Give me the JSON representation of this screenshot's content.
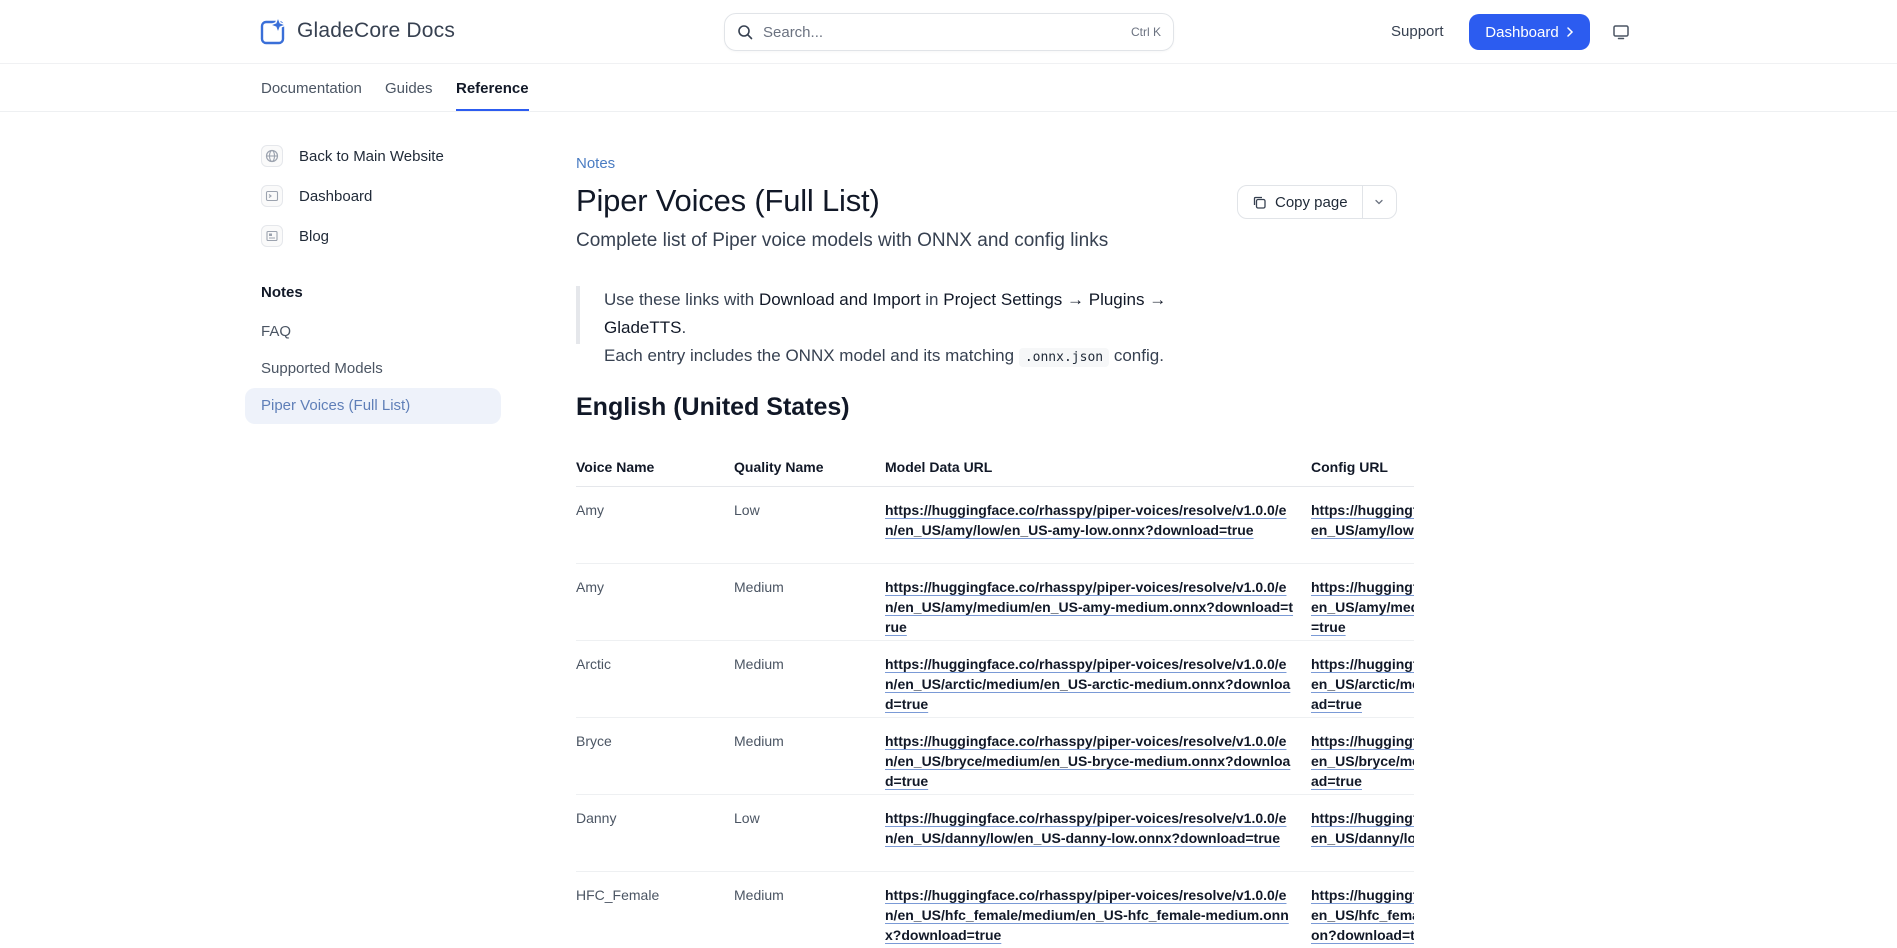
{
  "header": {
    "brand": "GladeCore Docs",
    "search_placeholder": "Search...",
    "search_shortcut": "Ctrl K",
    "support_label": "Support",
    "dashboard_label": "Dashboard",
    "accent_color": "#2c5cf0"
  },
  "tabs": [
    {
      "label": "Documentation",
      "active": false
    },
    {
      "label": "Guides",
      "active": false
    },
    {
      "label": "Reference",
      "active": true
    }
  ],
  "sidebar": {
    "links": [
      {
        "label": "Back to Main Website",
        "icon": "globe-icon"
      },
      {
        "label": "Dashboard",
        "icon": "terminal-icon"
      },
      {
        "label": "Blog",
        "icon": "newspaper-icon"
      }
    ],
    "group_title": "Notes",
    "items": [
      {
        "label": "FAQ",
        "active": false
      },
      {
        "label": "Supported Models",
        "active": false
      },
      {
        "label": "Piper Voices (Full List)",
        "active": true
      }
    ]
  },
  "page": {
    "eyebrow": "Notes",
    "title": "Piper Voices (Full List)",
    "subtitle": "Complete list of Piper voice models with ONNX and config links",
    "copy_label": "Copy page",
    "callout": {
      "l1_a": "Use these links with ",
      "l1_b": "Download and Import",
      "l1_c": " in ",
      "l1_d": "Project Settings → Plugins → GladeTTS",
      "l1_e": ".",
      "l2_a": "Each entry includes the ONNX model and its matching ",
      "l2_code": ".onnx.json",
      "l2_b": " config."
    },
    "section_title": "English (United States)"
  },
  "table": {
    "columns": [
      "Voice Name",
      "Quality Name",
      "Model Data URL",
      "Config URL"
    ],
    "rows": [
      {
        "voice": "Amy",
        "quality": "Low",
        "model": "https://huggingface.co/rhasspy/piper-voices/resolve/v1.0.0/en/en_US/amy/low/en_US-amy-low.onnx?download=true",
        "config": "https://huggingface.co/rhasspy/piper-voices/resolve/v1.0.0/en/en_US/amy/low/en_US-amy-low.onnx.json?download=true"
      },
      {
        "voice": "Amy",
        "quality": "Medium",
        "model": "https://huggingface.co/rhasspy/piper-voices/resolve/v1.0.0/en/en_US/amy/medium/en_US-amy-medium.onnx?download=true",
        "config": "https://huggingface.co/rhasspy/piper-voices/resolve/v1.0.0/en/en_US/amy/medium/en_US-amy-medium.onnx.json?download=true"
      },
      {
        "voice": "Arctic",
        "quality": "Medium",
        "model": "https://huggingface.co/rhasspy/piper-voices/resolve/v1.0.0/en/en_US/arctic/medium/en_US-arctic-medium.onnx?download=true",
        "config": "https://huggingface.co/rhasspy/piper-voices/resolve/v1.0.0/en/en_US/arctic/medium/en_US-arctic-medium.onnx.json?download=true"
      },
      {
        "voice": "Bryce",
        "quality": "Medium",
        "model": "https://huggingface.co/rhasspy/piper-voices/resolve/v1.0.0/en/en_US/bryce/medium/en_US-bryce-medium.onnx?download=true",
        "config": "https://huggingface.co/rhasspy/piper-voices/resolve/v1.0.0/en/en_US/bryce/medium/en_US-bryce-medium.onnx.json?download=true"
      },
      {
        "voice": "Danny",
        "quality": "Low",
        "model": "https://huggingface.co/rhasspy/piper-voices/resolve/v1.0.0/en/en_US/danny/low/en_US-danny-low.onnx?download=true",
        "config": "https://huggingface.co/rhasspy/piper-voices/resolve/v1.0.0/en/en_US/danny/low/en_US-danny-low.onnx.json?download=true"
      },
      {
        "voice": "HFC_Female",
        "quality": "Medium",
        "model": "https://huggingface.co/rhasspy/piper-voices/resolve/v1.0.0/en/en_US/hfc_female/medium/en_US-hfc_female-medium.onnx?download=true",
        "config": "https://huggingface.co/rhasspy/piper-voices/resolve/v1.0.0/en/en_US/hfc_female/medium/en_US-hfc_female-medium.onnx.json?download=true"
      }
    ]
  }
}
